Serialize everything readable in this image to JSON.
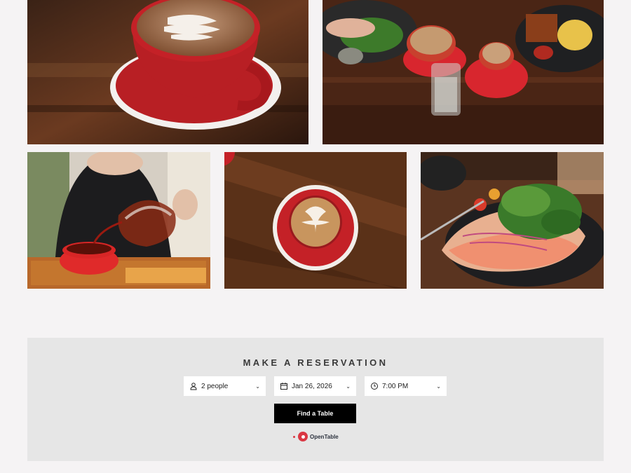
{
  "gallery": {
    "photos": [
      {
        "alt": "latte-art-cup"
      },
      {
        "alt": "brunch-table"
      },
      {
        "alt": "tea-pour"
      },
      {
        "alt": "coffee-overhead"
      },
      {
        "alt": "salmon-toast"
      }
    ]
  },
  "reservation": {
    "title": "MAKE A RESERVATION",
    "party": {
      "value": "2 people",
      "icon": "person-icon"
    },
    "date": {
      "value": "Jan 26, 2026",
      "icon": "calendar-icon"
    },
    "time": {
      "value": "7:00 PM",
      "icon": "clock-icon"
    },
    "button_label": "Find a Table",
    "provider": "OpenTable"
  },
  "colors": {
    "page_bg": "#f5f3f4",
    "panel_bg": "#e6e6e6",
    "button_bg": "#000000",
    "brand_red": "#da3743"
  }
}
